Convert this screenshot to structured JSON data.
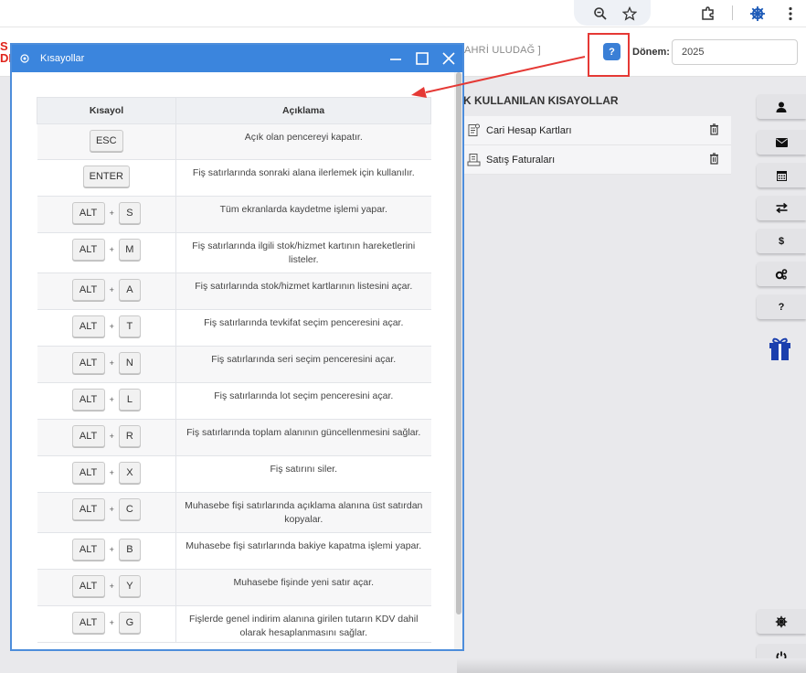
{
  "header": {
    "red_text_line1": "S",
    "red_text_line2": "DI",
    "user_name": "AHRİ ULUDAĞ ]",
    "help_button": "?",
    "period_label": "Dönem:",
    "period_value": "2025"
  },
  "frequent": {
    "title": "K KULLANILAN KISAYOLLAR",
    "items": [
      {
        "label": "Cari Hesap Kartları"
      },
      {
        "label": "Satış Faturaları"
      }
    ]
  },
  "side_buttons": [
    {
      "icon": "user-icon"
    },
    {
      "icon": "mail-icon"
    },
    {
      "icon": "calendar-icon"
    },
    {
      "icon": "transfer-icon"
    },
    {
      "icon": "dollar-icon",
      "text": "$"
    },
    {
      "icon": "cogs-icon"
    },
    {
      "icon": "question-icon",
      "text": "?"
    },
    {
      "icon": "helm-icon"
    },
    {
      "icon": "power-icon"
    }
  ],
  "dialog": {
    "title": "Kısayollar",
    "col_shortcut": "Kısayol",
    "col_description": "Açıklama",
    "plus": "+",
    "rows": [
      {
        "keys": [
          "ESC"
        ],
        "desc": "Açık olan pencereyi kapatır."
      },
      {
        "keys": [
          "ENTER"
        ],
        "desc": "Fiş satırlarında sonraki alana ilerlemek için kullanılır."
      },
      {
        "keys": [
          "ALT",
          "S"
        ],
        "desc": "Tüm ekranlarda kaydetme işlemi yapar."
      },
      {
        "keys": [
          "ALT",
          "M"
        ],
        "desc": "Fiş satırlarında ilgili stok/hizmet kartının hareketlerini listeler."
      },
      {
        "keys": [
          "ALT",
          "A"
        ],
        "desc": "Fiş satırlarında stok/hizmet kartlarının listesini açar."
      },
      {
        "keys": [
          "ALT",
          "T"
        ],
        "desc": "Fiş satırlarında tevkifat seçim penceresini açar."
      },
      {
        "keys": [
          "ALT",
          "N"
        ],
        "desc": "Fiş satırlarında seri seçim penceresini açar."
      },
      {
        "keys": [
          "ALT",
          "L"
        ],
        "desc": "Fiş satırlarında lot seçim penceresini açar."
      },
      {
        "keys": [
          "ALT",
          "R"
        ],
        "desc": "Fiş satırlarında toplam alanının güncellenmesini sağlar."
      },
      {
        "keys": [
          "ALT",
          "X"
        ],
        "desc": "Fiş satırını siler."
      },
      {
        "keys": [
          "ALT",
          "C"
        ],
        "desc": "Muhasebe fişi satırlarında açıklama alanına üst satırdan kopyalar."
      },
      {
        "keys": [
          "ALT",
          "B"
        ],
        "desc": "Muhasebe fişi satırlarında bakiye kapatma işlemi yapar."
      },
      {
        "keys": [
          "ALT",
          "Y"
        ],
        "desc": "Muhasebe fişinde yeni satır açar."
      },
      {
        "keys": [
          "ALT",
          "G"
        ],
        "desc": "Fişlerde genel indirim alanına girilen tutarın KDV dahil olarak hesaplanmasını sağlar."
      }
    ]
  },
  "colors": {
    "accent": "#3b85dd",
    "highlight": "#e53935",
    "gift": "#1b3fae"
  }
}
